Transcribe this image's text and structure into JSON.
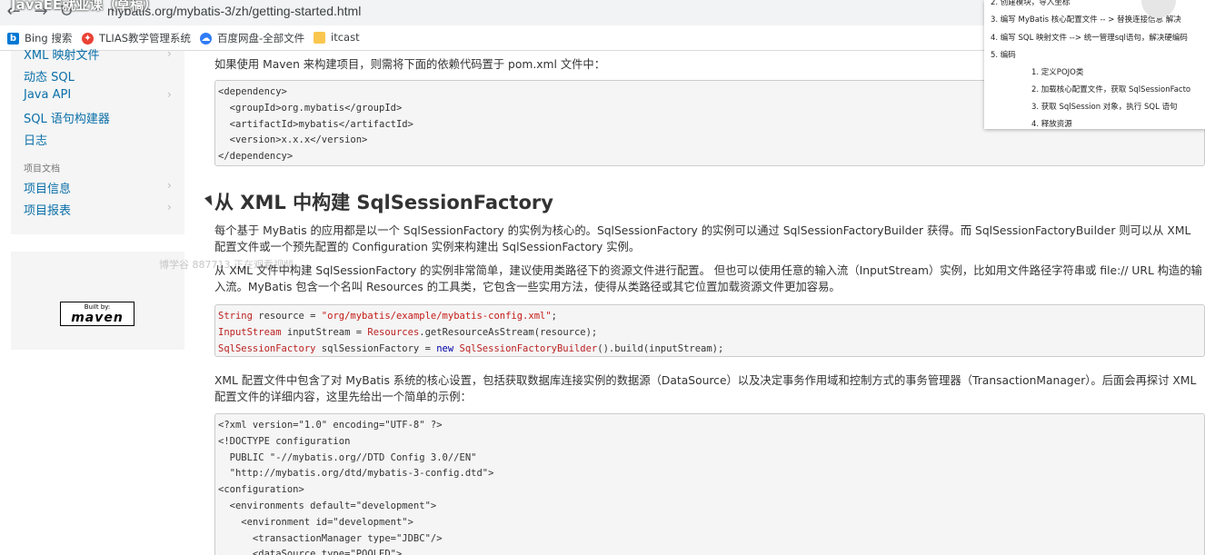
{
  "browser": {
    "url": "mybatis.org/mybatis-3/zh/getting-started.html",
    "overlay_title": "JavaEE就业课（草稿）",
    "bookmarks": [
      {
        "label": "Bing 搜索",
        "icon": "bing-icon",
        "color": "#0078d4"
      },
      {
        "label": "TLIAS教学管理系统",
        "icon": "tlias-icon",
        "color": "#e94235"
      },
      {
        "label": "百度网盘-全部文件",
        "icon": "baidu-pan-icon",
        "color": "#2e7cf6"
      },
      {
        "label": "itcast",
        "icon": "folder-icon",
        "color": "#f9c74f"
      }
    ]
  },
  "sidebar": {
    "items_top": [
      {
        "label": "XML 映射文件"
      },
      {
        "label": "动态 SQL"
      },
      {
        "label": "Java API"
      },
      {
        "label": "SQL 语句构建器"
      },
      {
        "label": "日志"
      }
    ],
    "section_heading": "项目文档",
    "items_bottom": [
      {
        "label": "项目信息"
      },
      {
        "label": "项目报表"
      }
    ],
    "maven_badge": {
      "built_by": "Built by:",
      "name": "maven"
    },
    "watermark": "博学谷 887713 正在观看视频"
  },
  "content": {
    "intro": "如果使用 Maven 来构建项目，则需将下面的依赖代码置于 pom.xml 文件中：",
    "dependency_code": [
      "<dependency>",
      "  <groupId>org.mybatis</groupId>",
      "  <artifactId>mybatis</artifactId>",
      "  <version>x.x.x</version>",
      "</dependency>"
    ],
    "heading": "从 XML 中构建 SqlSessionFactory",
    "para1": "每个基于 MyBatis 的应用都是以一个 SqlSessionFactory 的实例为核心的。SqlSessionFactory 的实例可以通过 SqlSessionFactoryBuilder 获得。而 SqlSessionFactoryBuilder 则可以从 XML 配置文件或一个预先配置的 Configuration 实例来构建出 SqlSessionFactory 实例。",
    "para2": "从 XML 文件中构建 SqlSessionFactory 的实例非常简单，建议使用类路径下的资源文件进行配置。 但也可以使用任意的输入流（InputStream）实例，比如用文件路径字符串或 file:// URL 构造的输入流。MyBatis 包含一个名叫 Resources 的工具类，它包含一些实用方法，使得从类路径或其它位置加载资源文件更加容易。",
    "java_code": {
      "line1_type": "String",
      "line1_rest": " resource = ",
      "line1_str": "\"org/mybatis/example/mybatis-config.xml\"",
      "line1_end": ";",
      "line2_type": "InputStream",
      "line2_mid": " inputStream = ",
      "line2_type2": "Resources",
      "line2_end": ".getResourceAsStream(resource);",
      "line3_type": "SqlSessionFactory",
      "line3_mid": " sqlSessionFactory = ",
      "line3_kw": "new",
      "line3_type2": " SqlSessionFactoryBuilder",
      "line3_end": "().build(inputStream);"
    },
    "para3": "XML 配置文件中包含了对 MyBatis 系统的核心设置，包括获取数据库连接实例的数据源（DataSource）以及决定事务作用域和控制方式的事务管理器（TransactionManager）。后面会再探讨 XML 配置文件的详细内容，这里先给出一个简单的示例：",
    "config_code": [
      "<?xml version=\"1.0\" encoding=\"UTF-8\" ?>",
      "<!DOCTYPE configuration",
      "  PUBLIC \"-//mybatis.org//DTD Config 3.0//EN\"",
      "  \"http://mybatis.org/dtd/mybatis-3-config.dtd\">",
      "<configuration>",
      "  <environments default=\"development\">",
      "    <environment id=\"development\">",
      "      <transactionManager type=\"JDBC\"/>",
      "      <dataSource type=\"POOLED\">"
    ]
  },
  "notes": {
    "lines": [
      "2.  创建模块，导入坐标",
      "3.  编写 MyBatis 核心配置文件  -- > 替换连接信息 解决",
      "4.  编写 SQL 映射文件 --> 统一管理sql语句，解决硬编码",
      "5.  编码",
      "1.  定义POJO类",
      "2.  加载核心配置文件，获取 SqlSessionFacto",
      "3.  获取 SqlSession 对象，执行 SQL 语句",
      "4.  释放资源"
    ]
  }
}
